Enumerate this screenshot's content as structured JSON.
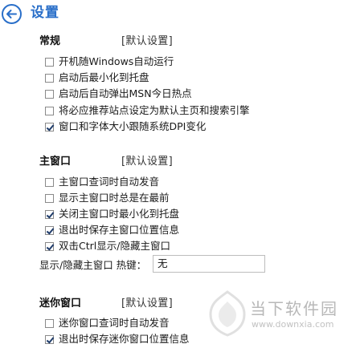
{
  "header": {
    "title": "设置"
  },
  "sections": {
    "general": {
      "title": "常规",
      "reset": "[默认设置]",
      "options": [
        {
          "label": "开机随Windows自动运行",
          "checked": false
        },
        {
          "label": "启动后最小化到托盘",
          "checked": false
        },
        {
          "label": "启动后自动弹出MSN今日热点",
          "checked": false
        },
        {
          "label": "将必应推荐站点设定为默认主页和搜索引擎",
          "checked": false
        },
        {
          "label": "窗口和字体大小跟随系统DPI变化",
          "checked": true
        }
      ]
    },
    "main_window": {
      "title": "主窗口",
      "reset": "[默认设置]",
      "options": [
        {
          "label": "主窗口查词时自动发音",
          "checked": false
        },
        {
          "label": "显示主窗口时总是在最前",
          "checked": false
        },
        {
          "label": "关闭主窗口时最小化到托盘",
          "checked": true
        },
        {
          "label": "退出时保存主窗口位置信息",
          "checked": true
        },
        {
          "label": "双击Ctrl显示/隐藏主窗口",
          "checked": true
        }
      ],
      "hotkey_label": "显示/隐藏主窗口 热键：",
      "hotkey_value": "无"
    },
    "mini_window": {
      "title": "迷你窗口",
      "reset": "[默认设置]",
      "options": [
        {
          "label": "迷你窗口查词时自动发音",
          "checked": false
        },
        {
          "label": "退出时保存迷你窗口位置信息",
          "checked": true
        }
      ]
    }
  },
  "watermark": {
    "name": "当下软件园",
    "url": "www.downxia.com"
  },
  "colors": {
    "accent": "#2a6fc9",
    "check": "#1f3c6b"
  }
}
